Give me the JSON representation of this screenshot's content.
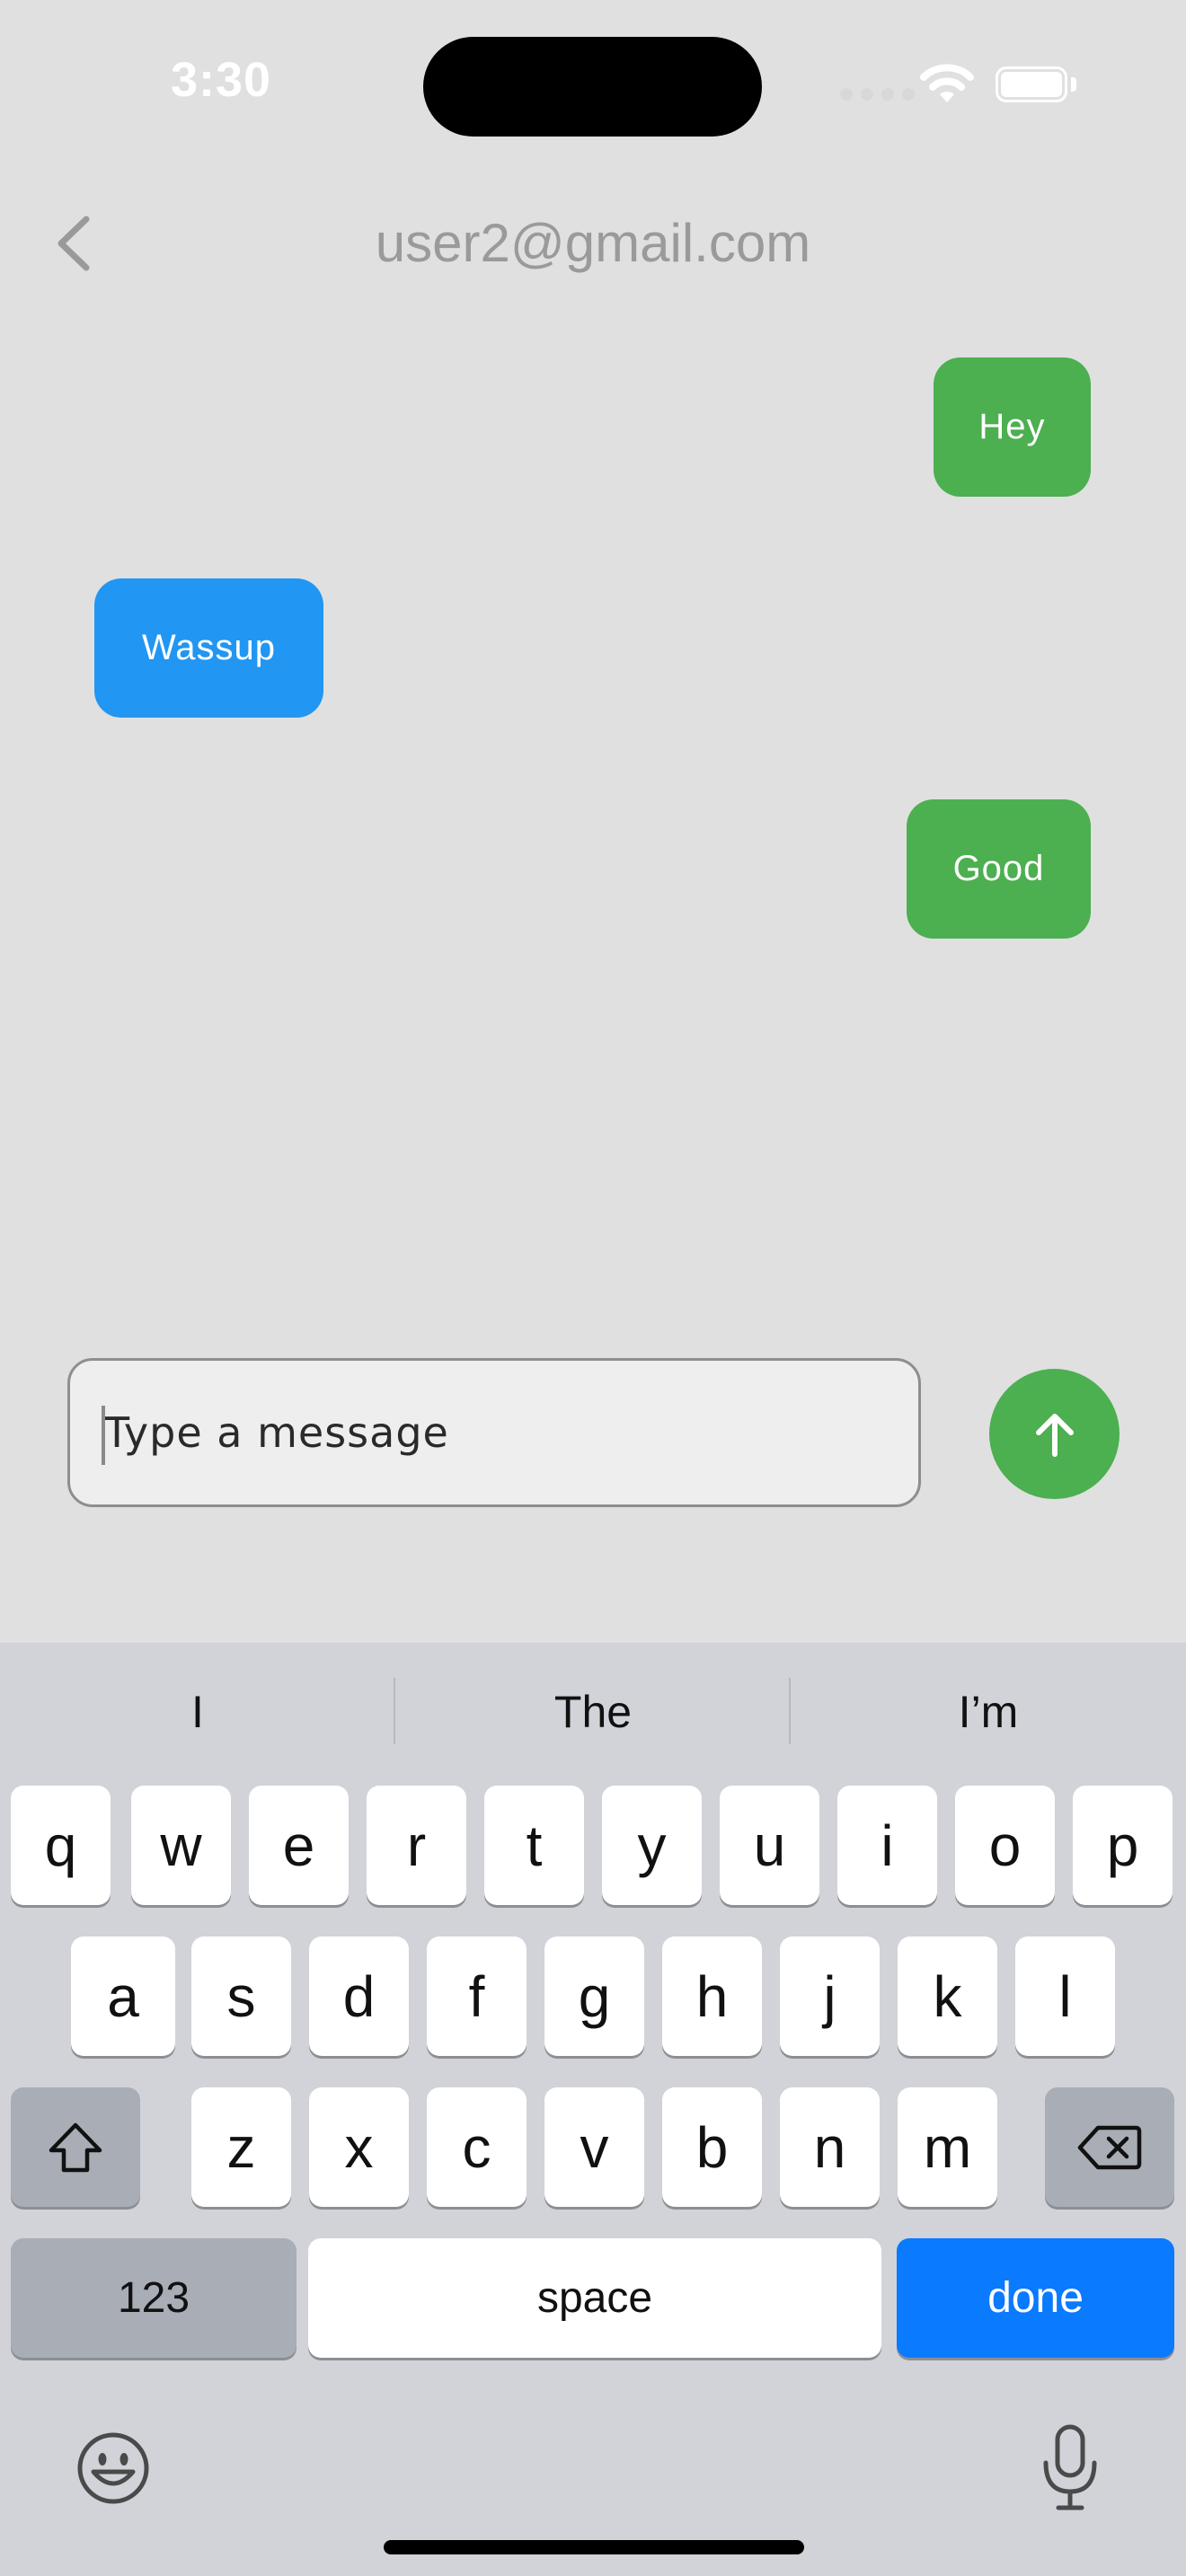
{
  "status_bar": {
    "time": "3:30"
  },
  "header": {
    "title": "user2@gmail.com"
  },
  "messages": [
    {
      "text": "Hey",
      "side": "sent",
      "color": "#4caf50"
    },
    {
      "text": "Wassup",
      "side": "received",
      "color": "#2196f3"
    },
    {
      "text": "Good",
      "side": "sent",
      "color": "#4caf50"
    }
  ],
  "composer": {
    "placeholder": "Type a message",
    "value": "",
    "send_icon": "arrow-up-icon"
  },
  "keyboard": {
    "suggestions": [
      "I",
      "The",
      "I’m"
    ],
    "row1": [
      "q",
      "w",
      "e",
      "r",
      "t",
      "y",
      "u",
      "i",
      "o",
      "p"
    ],
    "row2": [
      "a",
      "s",
      "d",
      "f",
      "g",
      "h",
      "j",
      "k",
      "l"
    ],
    "row3": [
      "z",
      "x",
      "c",
      "v",
      "b",
      "n",
      "m"
    ],
    "numbers_label": "123",
    "space_label": "space",
    "done_label": "done",
    "icons": [
      "shift-icon",
      "backspace-icon",
      "emoji-icon",
      "microphone-icon"
    ]
  },
  "colors": {
    "background": "#e0e0e0",
    "sent": "#4caf50",
    "received": "#2196f3",
    "done_key": "#0a7aff"
  }
}
